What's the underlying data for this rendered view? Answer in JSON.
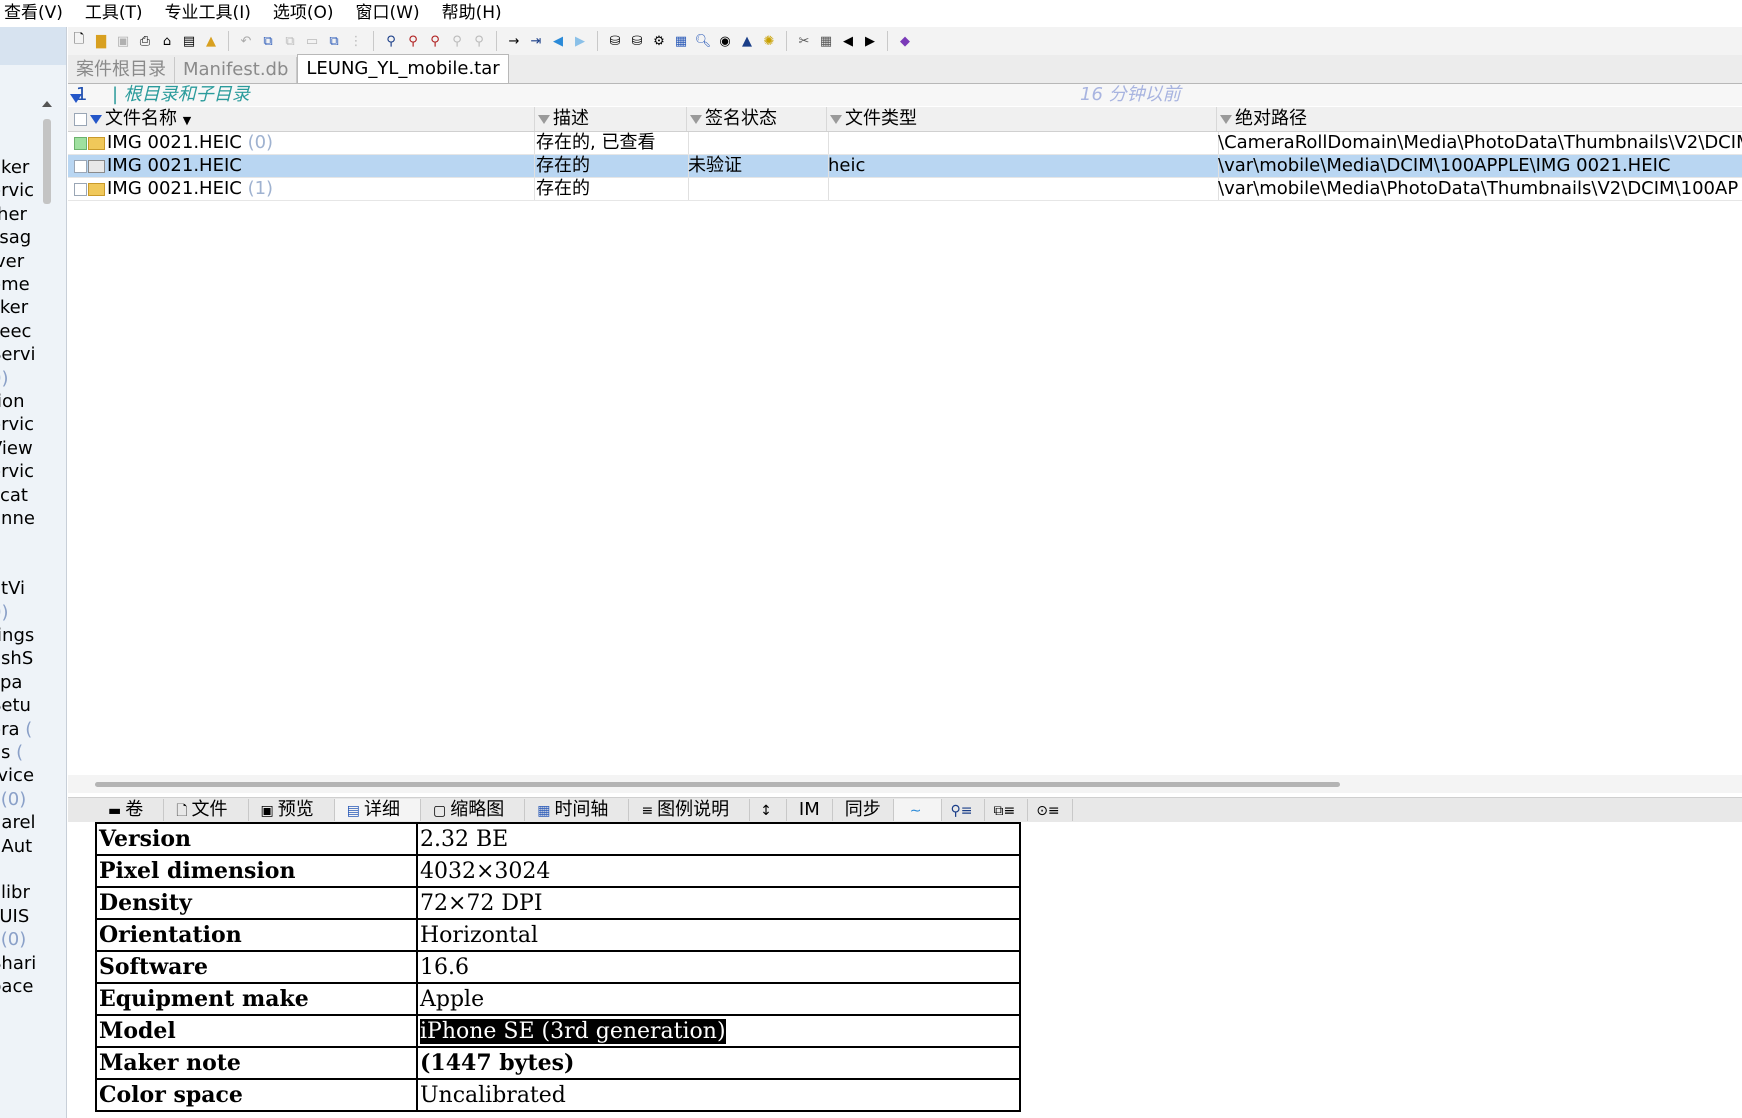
{
  "menu": [
    "查看(V)",
    "工具(T)",
    "专业工具(I)",
    "选项(O)",
    "窗口(W)",
    "帮助(H)"
  ],
  "left_panel": {
    "items": [
      {
        "text": "aker",
        "count": ""
      },
      {
        "text": "ervic",
        "count": ""
      },
      {
        "text": "ther",
        "count": ""
      },
      {
        "text": "ssag",
        "count": ""
      },
      {
        "text": "iver",
        "count": ""
      },
      {
        "text": "eme",
        "count": ""
      },
      {
        "text": "cker",
        "count": ""
      },
      {
        "text": "Feec",
        "count": ""
      },
      {
        "text": "Servi",
        "count": ""
      },
      {
        "text": "",
        "count": "0)"
      },
      {
        "text": "tion",
        "count": ""
      },
      {
        "text": "ervic",
        "count": ""
      },
      {
        "text": "View",
        "count": ""
      },
      {
        "text": "ervic",
        "count": ""
      },
      {
        "text": "licat",
        "count": ""
      },
      {
        "text": "anne",
        "count": ""
      },
      {
        "text": "",
        "count": ")"
      },
      {
        "text": "",
        "count": ""
      },
      {
        "text": "atVi",
        "count": ""
      },
      {
        "text": "",
        "count": "0)"
      },
      {
        "text": "tings",
        "count": ""
      },
      {
        "text": "ashS",
        "count": ""
      },
      {
        "text": "llpa",
        "count": ""
      },
      {
        "text": "Setu",
        "count": ""
      },
      {
        "text": "era",
        "count": " ("
      },
      {
        "text": "os",
        "count": " ("
      },
      {
        "text": "rvice",
        "count": ""
      },
      {
        "text": "l",
        "count": " (0)"
      },
      {
        "text": "harel",
        "count": ""
      },
      {
        "text": "nAut",
        "count": ""
      },
      {
        "text": "",
        "count": ")"
      },
      {
        "text": "alibr",
        "count": ""
      },
      {
        "text": "sUIS",
        "count": ""
      },
      {
        "text": "l",
        "count": " (0)"
      },
      {
        "text": "Shari",
        "count": ""
      },
      {
        "text": "pace",
        "count": ""
      }
    ]
  },
  "tabs": [
    "案件根目录",
    "Manifest.db",
    "LEUNG_YL_mobile.tar"
  ],
  "filter": {
    "count": "1",
    "path": "| 根目录和子目录",
    "time": "16 分钟以前"
  },
  "columns": [
    "文件名称",
    "描述",
    "签名状态",
    "文件类型",
    "绝对路径"
  ],
  "rows": [
    {
      "name": "IMG 0021.HEIC",
      "suffix": "(0)",
      "desc": "存在的, 已查看",
      "sig": "",
      "type": "",
      "path": "\\CameraRollDomain\\Media\\PhotoData\\Thumbnails\\V2\\DCIM"
    },
    {
      "name": "IMG 0021.HEIC",
      "suffix": "",
      "desc": "存在的",
      "sig": "未验证",
      "type": "heic",
      "path": "\\var\\mobile\\Media\\DCIM\\100APPLE\\IMG 0021.HEIC"
    },
    {
      "name": "IMG 0021.HEIC",
      "suffix": "(1)",
      "desc": "存在的",
      "sig": "",
      "type": "",
      "path": "\\var\\mobile\\Media\\PhotoData\\Thumbnails\\V2\\DCIM\\100AP"
    }
  ],
  "lower_tabs": [
    "卷",
    "文件",
    "预览",
    "详细",
    "缩略图",
    "时间轴",
    "图例说明",
    "IM",
    "同步"
  ],
  "details": [
    {
      "key": "Version",
      "value": "2.32 BE"
    },
    {
      "key": "Pixel dimension",
      "value": "4032×3024"
    },
    {
      "key": "Density",
      "value": "72×72 DPI"
    },
    {
      "key": "Orientation",
      "value": "Horizontal"
    },
    {
      "key": "Software",
      "value": "16.6"
    },
    {
      "key": "Equipment make",
      "value": "Apple"
    },
    {
      "key": "Model",
      "value": "iPhone SE (3rd generation)"
    },
    {
      "key": "Maker note",
      "value": "(1447 bytes)"
    },
    {
      "key": "Color space",
      "value": "Uncalibrated"
    }
  ]
}
